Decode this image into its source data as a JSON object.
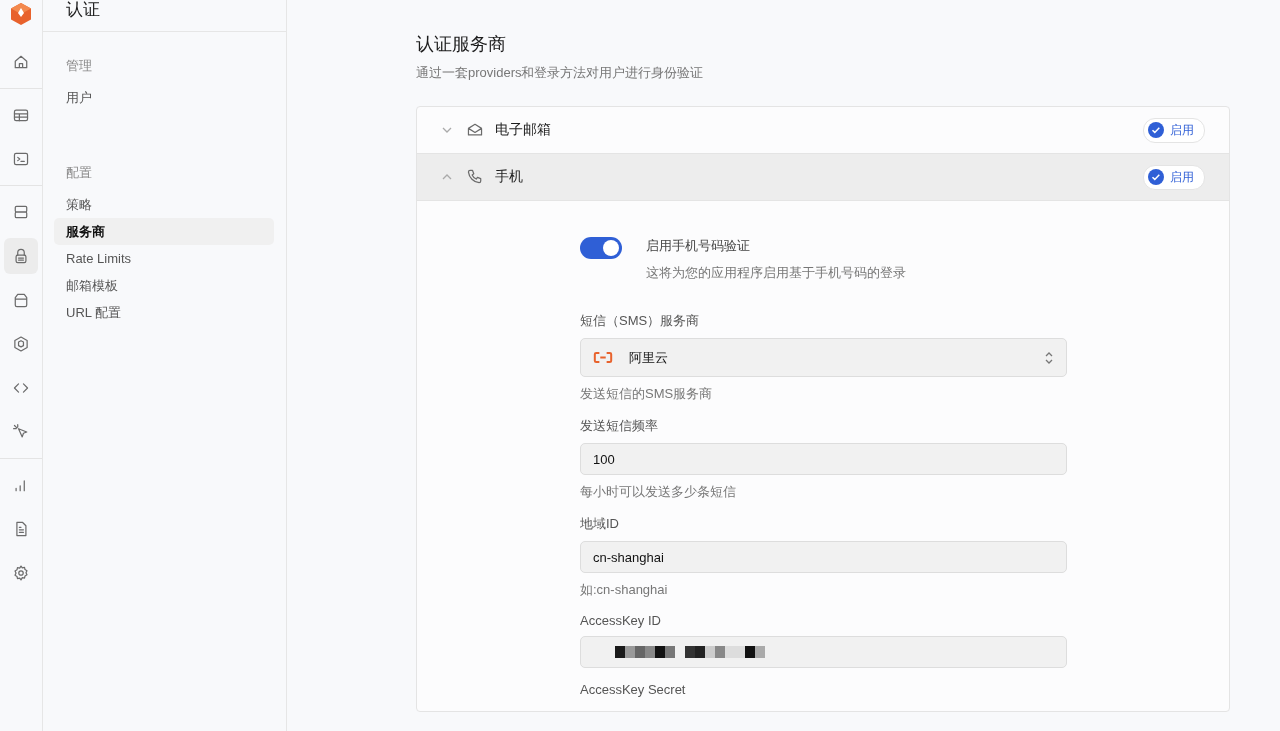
{
  "rail": {
    "items": [
      {
        "selected": false
      },
      {
        "selected": false
      },
      {
        "selected": false
      },
      {
        "selected": false
      },
      {
        "selected": true
      },
      {
        "selected": false
      },
      {
        "selected": false
      },
      {
        "selected": false
      },
      {
        "selected": false
      },
      {
        "selected": false
      },
      {
        "selected": false
      },
      {
        "selected": false
      }
    ]
  },
  "sidebar": {
    "title": "认证",
    "groups": [
      {
        "heading": "管理",
        "items": [
          {
            "label": "用户",
            "selected": false
          }
        ]
      },
      {
        "heading": "配置",
        "items": [
          {
            "label": "策略",
            "selected": false
          },
          {
            "label": "服务商",
            "selected": true
          },
          {
            "label": "Rate Limits",
            "selected": false
          },
          {
            "label": "邮箱模板",
            "selected": false
          },
          {
            "label": "URL 配置",
            "selected": false
          }
        ]
      }
    ]
  },
  "page": {
    "title": "认证服务商",
    "subtitle": "通过一套providers和登录方法对用户进行身份验证"
  },
  "providers": [
    {
      "name": "电子邮箱",
      "expanded": false,
      "badge": "启用"
    },
    {
      "name": "手机",
      "expanded": true,
      "badge": "启用"
    }
  ],
  "phone_settings": {
    "toggle": {
      "on": true,
      "label": "启用手机号码验证",
      "description": "这将为您的应用程序启用基于手机号码的登录"
    },
    "fields": [
      {
        "kind": "select",
        "label": "短信（SMS）服务商",
        "value": "阿里云",
        "help": "发送短信的SMS服务商"
      },
      {
        "kind": "text",
        "label": "发送短信频率",
        "value": "100",
        "help": "每小时可以发送多少条短信"
      },
      {
        "kind": "text",
        "label": "地域ID",
        "value": "cn-shanghai",
        "help": "如:cn-shanghai"
      },
      {
        "kind": "redacted",
        "label": "AccessKey ID"
      },
      {
        "kind": "label",
        "label": "AccessKey Secret"
      }
    ]
  }
}
